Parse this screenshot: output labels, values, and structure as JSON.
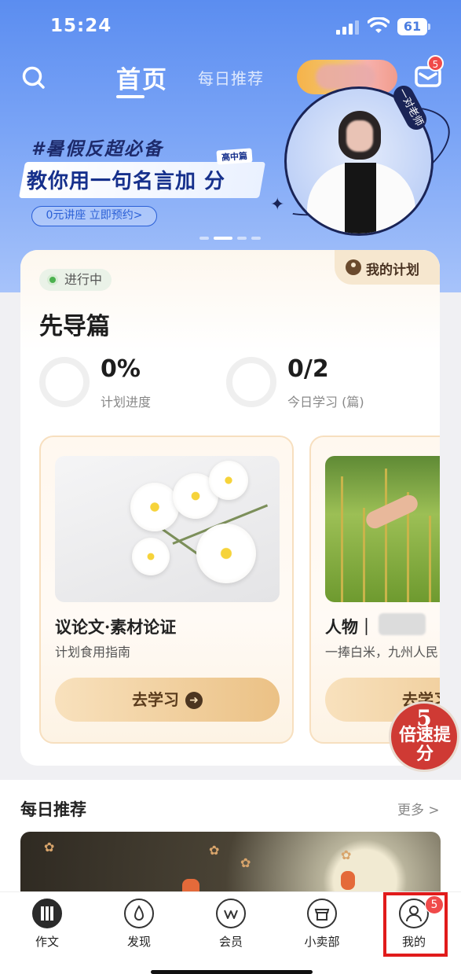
{
  "status_bar": {
    "time": "15:24",
    "battery": "61"
  },
  "header": {
    "tab_home": "首页",
    "tab_daily": "每日推荐",
    "mail_badge": "5"
  },
  "banner": {
    "tag": "#暑假反超必备",
    "title": "教你用一句名言加 分",
    "level_tag": "高中篇",
    "cta": "0元讲座 立即预约>",
    "teacher_label": "一对老师",
    "active_slide": 1,
    "slide_count": 4
  },
  "plan": {
    "my_plan_label": "我的计划",
    "status": "进行中",
    "title": "先导篇",
    "progress_value": "0%",
    "progress_label": "计划进度",
    "today_value": "0/2",
    "today_label": "今日学习 (篇)"
  },
  "courses": [
    {
      "title": "议论文·素材论证",
      "subtitle": "计划食用指南",
      "button": "去学习"
    },
    {
      "title": "人物｜",
      "subtitle": "一捧白米，九州人民",
      "button": "去学习"
    }
  ],
  "speed_badge": {
    "number": "5",
    "text": "倍速提分"
  },
  "daily": {
    "title": "每日推荐",
    "more": "更多 >"
  },
  "tabbar": {
    "items": [
      {
        "label": "作文"
      },
      {
        "label": "发现"
      },
      {
        "label": "会员"
      },
      {
        "label": "小卖部"
      },
      {
        "label": "我的",
        "badge": "5"
      }
    ]
  },
  "colors": {
    "accent_blue": "#5b8df0",
    "status_green": "#4bb14f",
    "badge_red": "#f04a4a",
    "button_gold": "#ebc185"
  }
}
